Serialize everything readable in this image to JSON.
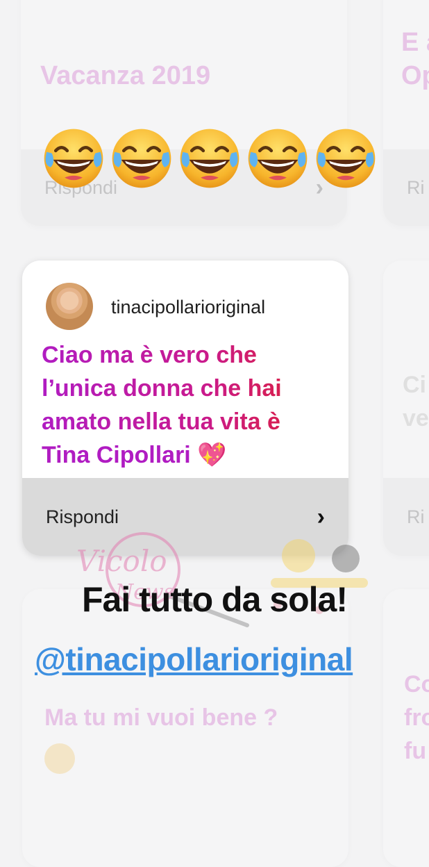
{
  "cards": {
    "top_left": {
      "question": "Vacanza 2019",
      "reply_label": "Rispondi"
    },
    "top_right": {
      "question_partial": "E a",
      "line2_partial": "Op",
      "reply_label": "Ri"
    },
    "main": {
      "username": "tinacipollarioriginal",
      "question_lines": [
        "Ciao ma è vero che",
        "l’unica donna che hai",
        "amato nella tua vita è",
        "Tina Cipollari"
      ],
      "emoji": "💖",
      "reply_label": "Rispondi",
      "reply_chevron": "›"
    },
    "mid_right": {
      "line1": "Ci",
      "line2": "ve",
      "reply_label": "Ri"
    },
    "bottom_left": {
      "question": "Ma tu mi vuoi bene ?"
    },
    "bottom_right": {
      "line1": "Co",
      "line2": "fro",
      "line3": "fu"
    }
  },
  "sticker_emojis": [
    "😂",
    "😂",
    "😂",
    "😂",
    "😂"
  ],
  "overlay": {
    "title": "Fai tutto da sola!",
    "mention": "@tinacipollarioriginal"
  },
  "watermark": {
    "logo_text": "Vicolo delle News"
  },
  "colors": {
    "question_gradient": [
      "#b01cc2",
      "#c91a8e",
      "#e0222c"
    ],
    "mention": "#3d8fe0",
    "footer": "#dadada"
  }
}
